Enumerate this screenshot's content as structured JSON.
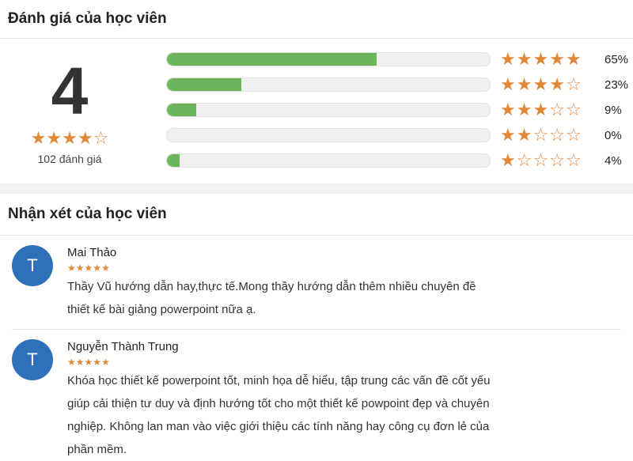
{
  "ratings_section": {
    "title": "Đánh giá của học viên",
    "average": "4",
    "average_value": 4,
    "review_count": "102 đánh giá",
    "rows": [
      {
        "stars": 5,
        "percent_label": "65%",
        "fill_percent": 65
      },
      {
        "stars": 4,
        "percent_label": "23%",
        "fill_percent": 23
      },
      {
        "stars": 3,
        "percent_label": "9%",
        "fill_percent": 9
      },
      {
        "stars": 2,
        "percent_label": "0%",
        "fill_percent": 0
      },
      {
        "stars": 1,
        "percent_label": "4%",
        "fill_percent": 4
      }
    ],
    "colors": {
      "bar_fill": "#6db65b",
      "star": "#e0893a"
    }
  },
  "reviews_section": {
    "title": "Nhận xét của học viên",
    "reviews": [
      {
        "avatar_letter": "T",
        "name": "Mai Thảo",
        "stars": 5,
        "text": "Thầy Vũ hướng dẫn hay,thực tế.Mong thầy hướng dẫn thêm nhiều chuyên đề thiết kế bài giảng powerpoint nữa ạ."
      },
      {
        "avatar_letter": "T",
        "name": "Nguyễn Thành Trung",
        "stars": 5,
        "text": "Khóa học thiết kế powerpoint tốt, minh họa dễ hiểu, tập trung các vấn đề cốt yếu giúp cải thiện tư duy và định hướng tốt cho một thiết kế powpoint đẹp và chuyên nghiệp. Không lan man vào việc giới thiệu các tính năng hay công cụ đơn lẻ của phần mềm."
      }
    ],
    "colors": {
      "avatar_bg": "#2f71b8"
    }
  }
}
